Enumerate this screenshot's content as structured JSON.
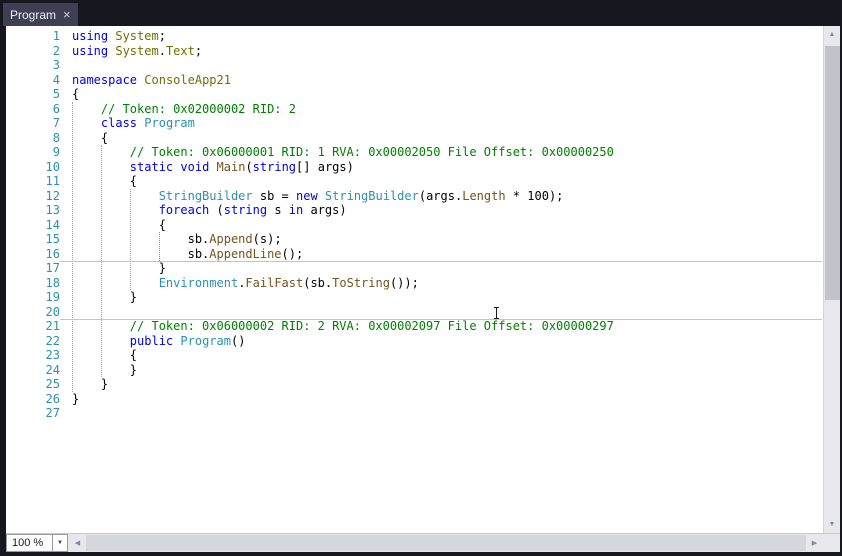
{
  "window": {
    "tab": {
      "title": "Program"
    }
  },
  "icons": {
    "close": "×",
    "dropdown": "▼",
    "scroll_up": "▲",
    "scroll_down": "▼",
    "scroll_left": "◀",
    "scroll_right": "▶"
  },
  "zoom_control": {
    "value": "100 %"
  },
  "colors": {
    "chrome_bg": "#16161F",
    "tab_active_bg": "#3F3F54",
    "tab_text": "#F0F0F5",
    "editor_bg": "#FFFFFF",
    "line_number": "#2B91AF",
    "keyword": "#0000E6",
    "namespace": "#6F6F00",
    "type": "#2B91AF",
    "method": "#74531F",
    "comment": "#008000",
    "identifier": "#000000",
    "number": "#000000",
    "plain": "#000000",
    "guide": "#A0A0A0",
    "guide_highlight": "#CC6699",
    "separator": "#C4C4C4",
    "scrollbar_track": "#E8E8EC",
    "scrollbar_thumb": "#C2C3C9",
    "scrollbar_arrow": "#868999",
    "zoom_border": "#9A9AA0",
    "zoom_bg": "#FFFFFF",
    "zoom_text": "#1A1A1A"
  },
  "editor": {
    "lines": [
      {
        "n": 1,
        "tokens": [
          [
            "keyword",
            "using"
          ],
          [
            "plain",
            " "
          ],
          [
            "namespace",
            "System"
          ],
          [
            "plain",
            ";"
          ]
        ]
      },
      {
        "n": 2,
        "tokens": [
          [
            "keyword",
            "using"
          ],
          [
            "plain",
            " "
          ],
          [
            "namespace",
            "System"
          ],
          [
            "plain",
            "."
          ],
          [
            "namespace",
            "Text"
          ],
          [
            "plain",
            ";"
          ]
        ]
      },
      {
        "n": 3,
        "tokens": []
      },
      {
        "n": 4,
        "tokens": [
          [
            "keyword",
            "namespace"
          ],
          [
            "plain",
            " "
          ],
          [
            "namespace",
            "ConsoleApp21"
          ]
        ]
      },
      {
        "n": 5,
        "tokens": [
          [
            "plain",
            "{"
          ]
        ]
      },
      {
        "n": 6,
        "tokens": [
          [
            "plain",
            "    "
          ],
          [
            "comment",
            "// Token: 0x02000002 RID: 2"
          ]
        ]
      },
      {
        "n": 7,
        "tokens": [
          [
            "plain",
            "    "
          ],
          [
            "keyword",
            "class"
          ],
          [
            "plain",
            " "
          ],
          [
            "type",
            "Program"
          ]
        ]
      },
      {
        "n": 8,
        "tokens": [
          [
            "plain",
            "    {"
          ]
        ]
      },
      {
        "n": 9,
        "tokens": [
          [
            "plain",
            "        "
          ],
          [
            "comment",
            "// Token: 0x06000001 RID: 1 RVA: 0x00002050 File Offset: 0x00000250"
          ]
        ]
      },
      {
        "n": 10,
        "tokens": [
          [
            "plain",
            "        "
          ],
          [
            "keyword",
            "static"
          ],
          [
            "plain",
            " "
          ],
          [
            "keyword",
            "void"
          ],
          [
            "plain",
            " "
          ],
          [
            "method",
            "Main"
          ],
          [
            "plain",
            "("
          ],
          [
            "keyword",
            "string"
          ],
          [
            "plain",
            "[] "
          ],
          [
            "identifier",
            "args"
          ],
          [
            "plain",
            ")"
          ]
        ]
      },
      {
        "n": 11,
        "tokens": [
          [
            "plain",
            "        {"
          ]
        ]
      },
      {
        "n": 12,
        "tokens": [
          [
            "plain",
            "            "
          ],
          [
            "type",
            "StringBuilder"
          ],
          [
            "plain",
            " "
          ],
          [
            "identifier",
            "sb"
          ],
          [
            "plain",
            " = "
          ],
          [
            "keyword",
            "new"
          ],
          [
            "plain",
            " "
          ],
          [
            "type",
            "StringBuilder"
          ],
          [
            "plain",
            "("
          ],
          [
            "identifier",
            "args"
          ],
          [
            "plain",
            "."
          ],
          [
            "method",
            "Length"
          ],
          [
            "plain",
            " * "
          ],
          [
            "number",
            "100"
          ],
          [
            "plain",
            ");"
          ]
        ]
      },
      {
        "n": 13,
        "tokens": [
          [
            "plain",
            "            "
          ],
          [
            "keyword",
            "foreach"
          ],
          [
            "plain",
            " ("
          ],
          [
            "keyword",
            "string"
          ],
          [
            "plain",
            " "
          ],
          [
            "identifier",
            "s"
          ],
          [
            "plain",
            " "
          ],
          [
            "keyword",
            "in"
          ],
          [
            "plain",
            " "
          ],
          [
            "identifier",
            "args"
          ],
          [
            "plain",
            ")"
          ]
        ]
      },
      {
        "n": 14,
        "tokens": [
          [
            "plain",
            "            {"
          ]
        ]
      },
      {
        "n": 15,
        "tokens": [
          [
            "plain",
            "                "
          ],
          [
            "identifier",
            "sb"
          ],
          [
            "plain",
            "."
          ],
          [
            "method",
            "Append"
          ],
          [
            "plain",
            "("
          ],
          [
            "identifier",
            "s"
          ],
          [
            "plain",
            ");"
          ]
        ]
      },
      {
        "n": 16,
        "tokens": [
          [
            "plain",
            "                "
          ],
          [
            "identifier",
            "sb"
          ],
          [
            "plain",
            "."
          ],
          [
            "method",
            "AppendLine"
          ],
          [
            "plain",
            "();"
          ]
        ]
      },
      {
        "n": 17,
        "tokens": [
          [
            "plain",
            "            }"
          ]
        ]
      },
      {
        "n": 18,
        "tokens": [
          [
            "plain",
            "            "
          ],
          [
            "type",
            "Environment"
          ],
          [
            "plain",
            "."
          ],
          [
            "method",
            "FailFast"
          ],
          [
            "plain",
            "("
          ],
          [
            "identifier",
            "sb"
          ],
          [
            "plain",
            "."
          ],
          [
            "method",
            "ToString"
          ],
          [
            "plain",
            "());"
          ]
        ]
      },
      {
        "n": 19,
        "tokens": [
          [
            "plain",
            "        }"
          ]
        ]
      },
      {
        "n": 20,
        "tokens": []
      },
      {
        "n": 21,
        "tokens": [
          [
            "plain",
            "        "
          ],
          [
            "comment",
            "// Token: 0x06000002 RID: 2 RVA: 0x00002097 File Offset: 0x00000297"
          ]
        ]
      },
      {
        "n": 22,
        "tokens": [
          [
            "plain",
            "        "
          ],
          [
            "keyword",
            "public"
          ],
          [
            "plain",
            " "
          ],
          [
            "type",
            "Program"
          ],
          [
            "plain",
            "()"
          ]
        ]
      },
      {
        "n": 23,
        "tokens": [
          [
            "plain",
            "        {"
          ]
        ]
      },
      {
        "n": 24,
        "tokens": [
          [
            "plain",
            "        }"
          ]
        ]
      },
      {
        "n": 25,
        "tokens": [
          [
            "plain",
            "    }"
          ]
        ]
      },
      {
        "n": 26,
        "tokens": [
          [
            "plain",
            "}"
          ]
        ]
      },
      {
        "n": 27,
        "tokens": []
      }
    ],
    "indent_guides": [
      {
        "col": 0,
        "from": 6,
        "to": 25,
        "highlight": false
      },
      {
        "col": 4,
        "from": 9,
        "to": 24,
        "highlight": false
      },
      {
        "col": 8,
        "from": 12,
        "to": 18,
        "highlight": false
      },
      {
        "col": 12,
        "from": 15,
        "to": 16,
        "highlight": true
      }
    ],
    "separators_after_lines": [
      16,
      20
    ]
  }
}
